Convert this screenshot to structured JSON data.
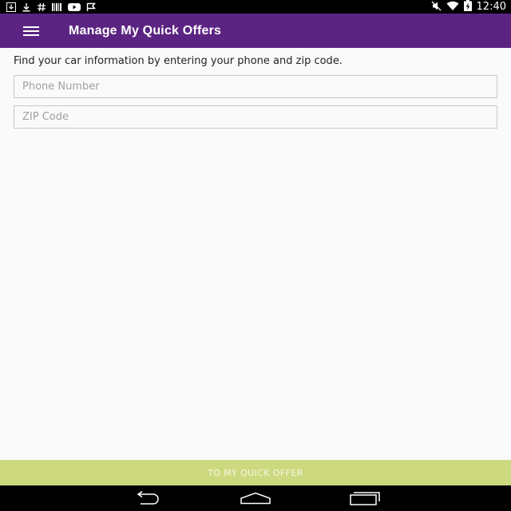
{
  "status_bar": {
    "time": "12:40",
    "left_icons": [
      "download-box-icon",
      "download-icon",
      "hash-icon",
      "barcode-icon",
      "youtube-icon",
      "flag-icon"
    ],
    "right_icons": [
      "mute-icon",
      "wifi-icon",
      "battery-charging-icon"
    ]
  },
  "app_bar": {
    "menu_icon": "hamburger-menu-icon",
    "title": "Manage My Quick Offers",
    "color": "#5c2482"
  },
  "form": {
    "instructions": "Find your car information by entering your phone and zip code.",
    "phone": {
      "value": "",
      "placeholder": "Phone Number"
    },
    "zip": {
      "value": "",
      "placeholder": "ZIP Code"
    }
  },
  "cta": {
    "label": "TO MY QUICK OFFER",
    "color": "#cdd97e"
  },
  "nav_bar": {
    "buttons": [
      "back-icon",
      "home-icon",
      "recent-apps-icon"
    ]
  }
}
